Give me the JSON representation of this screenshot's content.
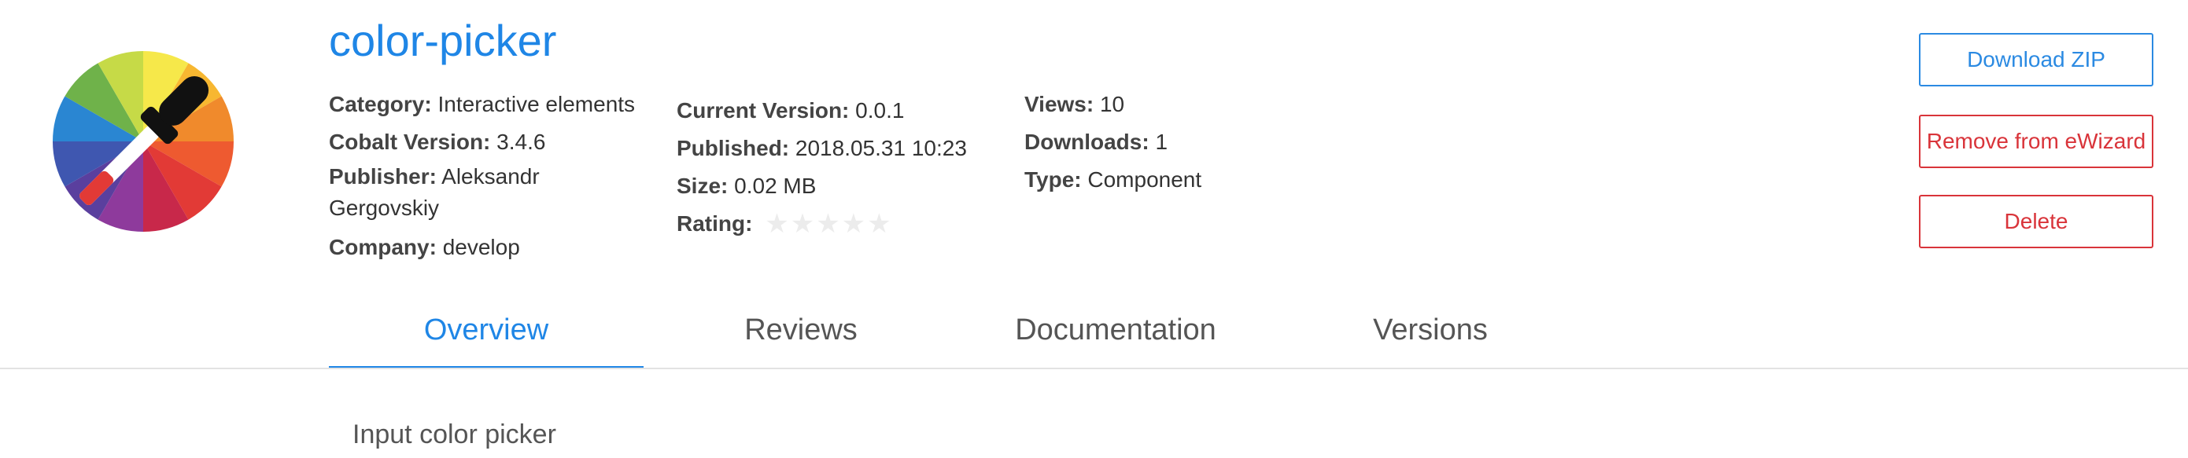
{
  "package": {
    "name": "color-picker",
    "logo_icon": "color-wheel-eyedropper-icon"
  },
  "meta": {
    "category": {
      "label": "Category:",
      "value": "Interactive elements"
    },
    "cobalt_version": {
      "label": "Cobalt Version:",
      "value": "3.4.6"
    },
    "publisher": {
      "label": "Publisher:",
      "value": "Aleksandr Gergovskiy"
    },
    "company": {
      "label": "Company:",
      "value": "develop"
    },
    "current_version": {
      "label": "Current Version:",
      "value": "0.0.1"
    },
    "published": {
      "label": "Published:",
      "value": "2018.05.31 10:23"
    },
    "size": {
      "label": "Size:",
      "value": "0.02 MB"
    },
    "rating": {
      "label": "Rating:",
      "value": 0,
      "max": 5
    },
    "views": {
      "label": "Views:",
      "value": "10"
    },
    "downloads": {
      "label": "Downloads:",
      "value": "1"
    },
    "type": {
      "label": "Type:",
      "value": "Component"
    }
  },
  "actions": {
    "download_label": "Download ZIP",
    "remove_label": "Remove from eWizard",
    "delete_label": "Delete",
    "primary_color": "#2b8ae2",
    "danger_color": "#d9343a"
  },
  "tabs": [
    {
      "label": "Overview",
      "active": true
    },
    {
      "label": "Reviews",
      "active": false
    },
    {
      "label": "Documentation",
      "active": false
    },
    {
      "label": "Versions",
      "active": false
    }
  ],
  "overview": {
    "description": "Input color picker"
  },
  "colors": {
    "accent": "#1f86e6",
    "text": "#333333"
  }
}
